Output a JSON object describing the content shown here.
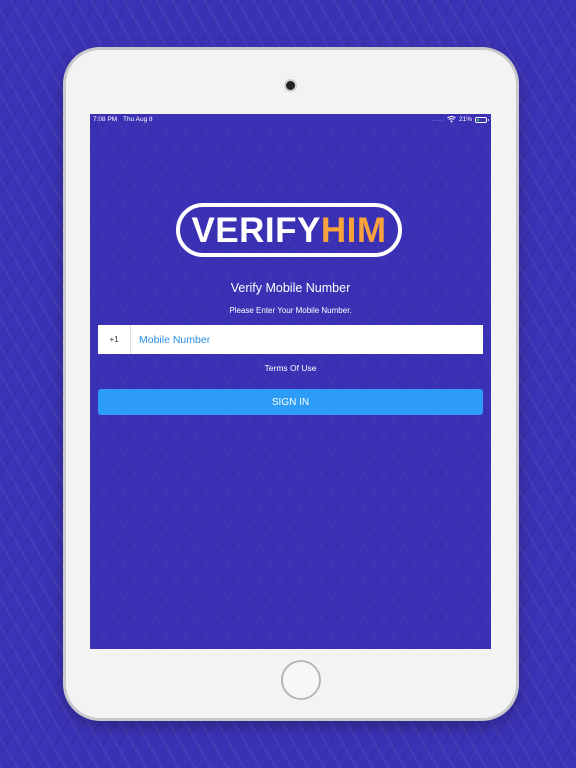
{
  "status_bar": {
    "time": "7:08 PM",
    "date": "Thu Aug 8",
    "signal": ".....",
    "battery_percent": "21%",
    "battery_level": 0.21
  },
  "logo": {
    "part1": "VERIFY",
    "part2": "HIM"
  },
  "heading": "Verify Mobile Number",
  "subheading": "Please Enter Your Mobile Number.",
  "phone": {
    "country_code": "+1",
    "placeholder": "Mobile Number",
    "value": ""
  },
  "terms_label": "Terms Of Use",
  "signin_label": "SIGN IN",
  "colors": {
    "background": "#3b33b6",
    "accent": "#2d9cf6",
    "logo_orange": "#f7a23c",
    "input_text": "#2a8fe6"
  },
  "icons": {
    "wifi": "wifi-icon",
    "battery": "battery-icon",
    "camera": "camera-icon",
    "home": "home-button"
  }
}
